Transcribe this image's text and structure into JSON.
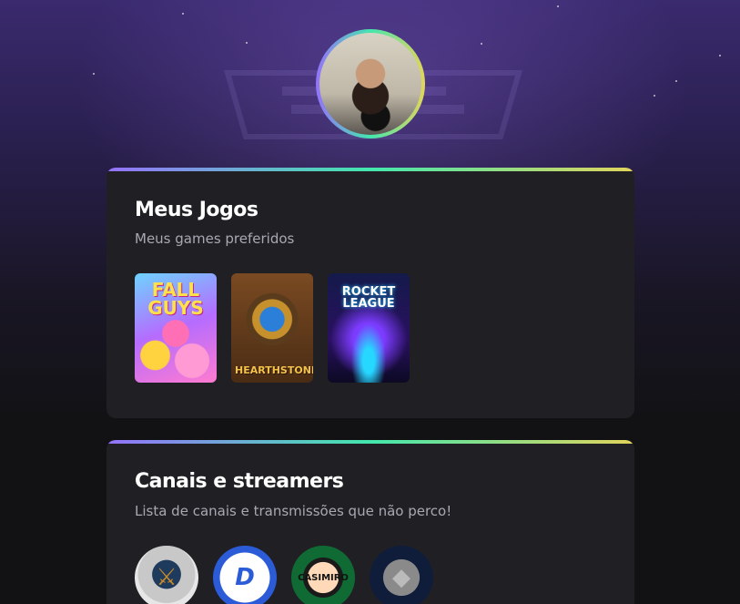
{
  "profile": {
    "avatar_icon": "user-photo-avatar"
  },
  "theme": {
    "background": "#121214",
    "card": "#202024",
    "gradient": [
      "#9572fc",
      "#43e7ad",
      "#e2d45c"
    ],
    "title": "#ffffff",
    "subtitle": "#a8a8b3"
  },
  "games_section": {
    "title": "Meus Jogos",
    "subtitle": "Meus games preferidos",
    "games": [
      {
        "name": "Fall Guys",
        "cover_text": "FALL GUYS"
      },
      {
        "name": "Hearthstone",
        "cover_text": "HEARTHSTONE"
      },
      {
        "name": "Rocket League",
        "cover_text": "ROCKET LEAGUE"
      }
    ]
  },
  "channels_section": {
    "title": "Canais e streamers",
    "subtitle": "Lista de canais e transmissões que não perco!",
    "channels": [
      {
        "icon": "knight-helmet-logo",
        "glyph": "⚔"
      },
      {
        "icon": "d-letter-logo",
        "glyph": "D"
      },
      {
        "icon": "casimiro-cartoon-logo",
        "glyph": "CASIMIRO"
      },
      {
        "icon": "asteroid-logo",
        "glyph": "◆"
      }
    ]
  }
}
